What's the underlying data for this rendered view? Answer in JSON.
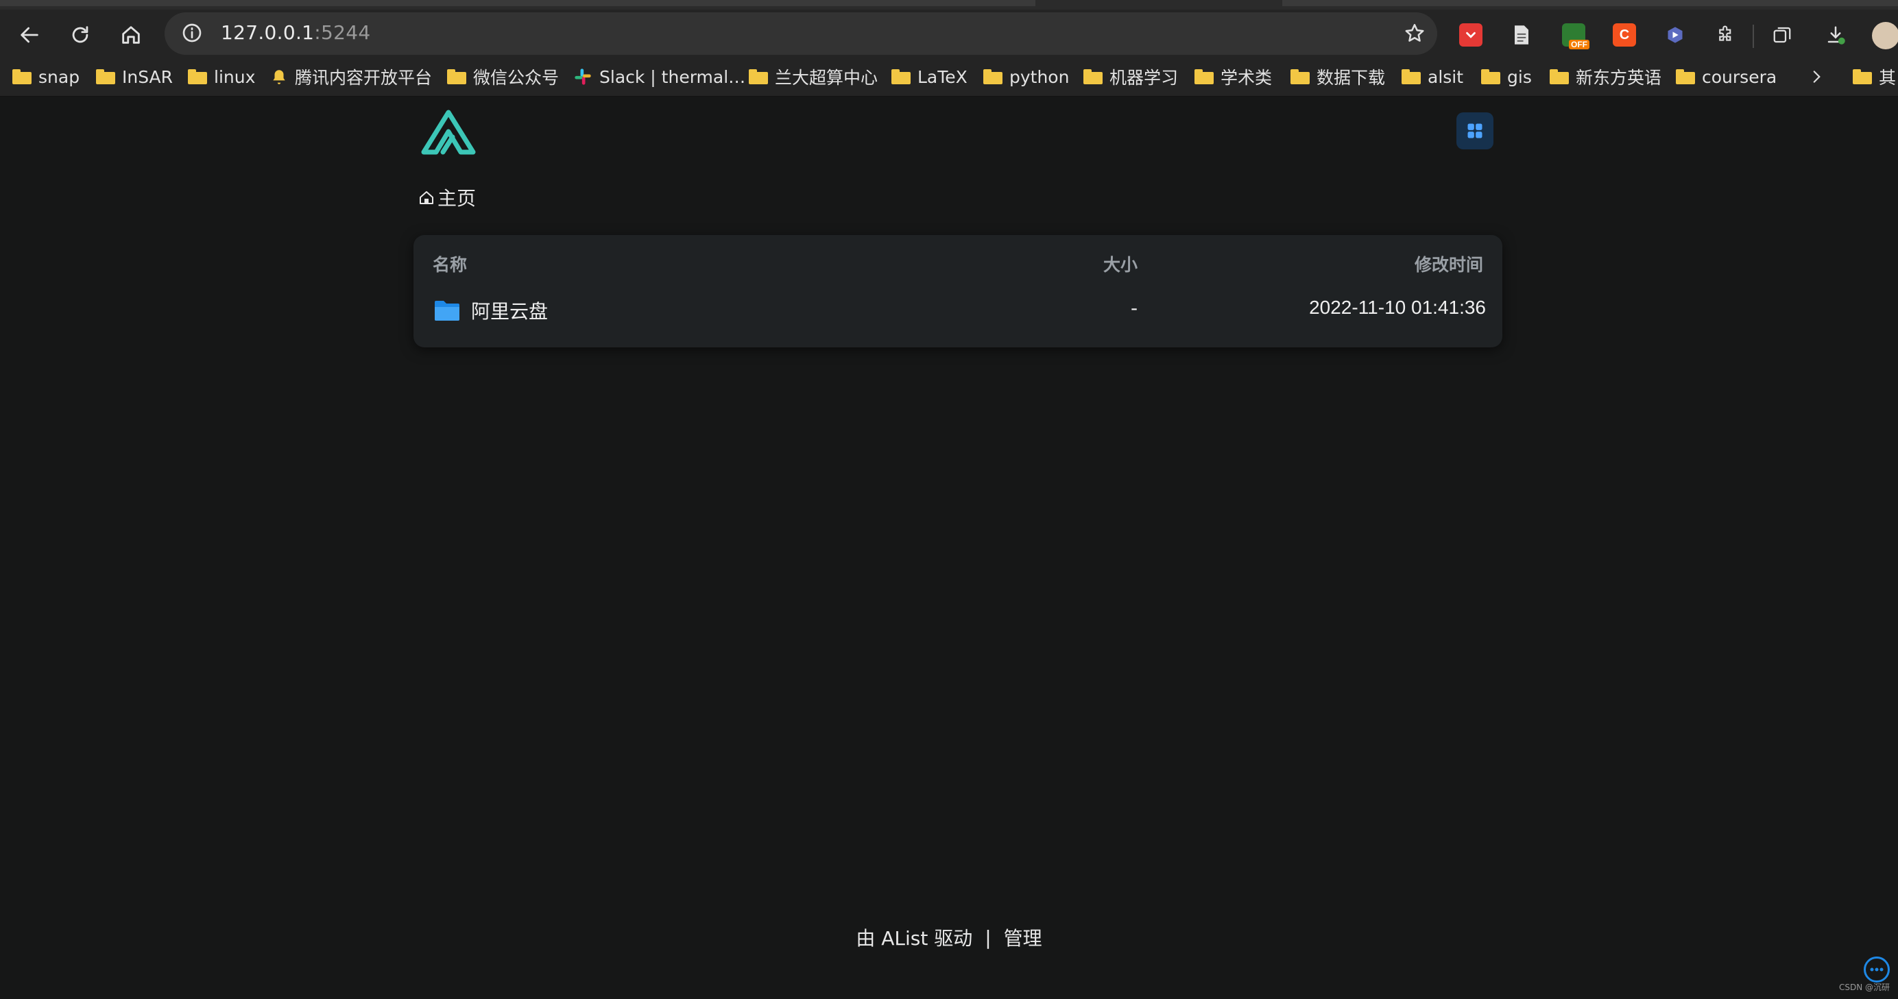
{
  "browser": {
    "url_host": "127.0.0.1",
    "url_port": ":5244",
    "bookmarks": [
      {
        "label": "snap",
        "icon": "folder-icon"
      },
      {
        "label": "InSAR",
        "icon": "folder-icon"
      },
      {
        "label": "linux",
        "icon": "folder-icon"
      },
      {
        "label": "腾讯内容开放平台",
        "icon": "bell-icon"
      },
      {
        "label": "微信公众号",
        "icon": "folder-icon"
      },
      {
        "label": "Slack | thermal…",
        "icon": "slack-icon"
      },
      {
        "label": "兰大超算中心",
        "icon": "folder-icon"
      },
      {
        "label": "LaTeX",
        "icon": "folder-icon"
      },
      {
        "label": "python",
        "icon": "folder-icon"
      },
      {
        "label": "机器学习",
        "icon": "folder-icon"
      },
      {
        "label": "学术类",
        "icon": "folder-icon"
      },
      {
        "label": "数据下载",
        "icon": "folder-icon"
      },
      {
        "label": "alsit",
        "icon": "folder-icon"
      },
      {
        "label": "gis",
        "icon": "folder-icon"
      },
      {
        "label": "新东方英语",
        "icon": "folder-icon"
      },
      {
        "label": "coursera",
        "icon": "folder-icon"
      },
      {
        "label": "其",
        "icon": "folder-icon"
      }
    ],
    "extension_badge": "OFF",
    "ext_c_label": "C"
  },
  "page": {
    "breadcrumb_home": "主页",
    "columns": {
      "name": "名称",
      "size": "大小",
      "modified": "修改时间"
    },
    "files": [
      {
        "name": "阿里云盘",
        "size": "-",
        "modified": "2022-11-10 01:41:36",
        "type": "folder"
      }
    ],
    "footer": {
      "powered": "由 AList 驱动",
      "divider": "|",
      "admin": "管理"
    },
    "watermark": "CSDN @沉研"
  },
  "colors": {
    "accent": "#1e88e5",
    "logo": "#3cc6b7",
    "background": "#161717"
  }
}
